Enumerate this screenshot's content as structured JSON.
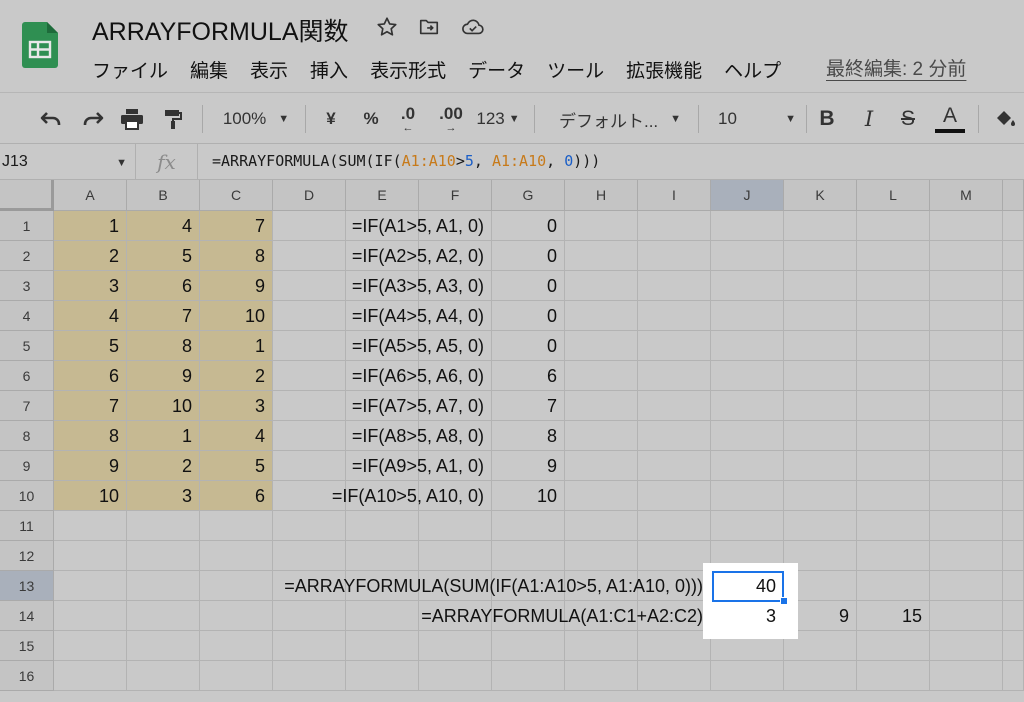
{
  "header": {
    "title": "ARRAYFORMULA関数",
    "menu": [
      "ファイル",
      "編集",
      "表示",
      "挿入",
      "表示形式",
      "データ",
      "ツール",
      "拡張機能",
      "ヘルプ"
    ],
    "last_edit": "最終編集: 2 分前"
  },
  "toolbar": {
    "zoom": "100%",
    "currency": "¥",
    "percent": "%",
    "decimal_decrease": ".0",
    "decimal_increase": ".00",
    "number_format": "123",
    "font": "デフォルト...",
    "font_size": "10",
    "bold": "B",
    "italic": "I",
    "strike": "S",
    "text_color": "A"
  },
  "formula_bar": {
    "name_box": "J13",
    "fx": "fx",
    "formula_parts": [
      {
        "t": "=ARRAYFORMULA(SUM(IF(",
        "c": ""
      },
      {
        "t": "A1:A10",
        "c": "ref-a"
      },
      {
        "t": ">",
        "c": ""
      },
      {
        "t": "5",
        "c": "ref-n"
      },
      {
        "t": ", ",
        "c": ""
      },
      {
        "t": "A1:A10",
        "c": "ref-a"
      },
      {
        "t": ", ",
        "c": ""
      },
      {
        "t": "0",
        "c": "ref-n"
      },
      {
        "t": ")))",
        "c": ""
      }
    ]
  },
  "sheet": {
    "columns": [
      "A",
      "B",
      "C",
      "D",
      "E",
      "F",
      "G",
      "H",
      "I",
      "J",
      "K",
      "L",
      "M"
    ],
    "rows": [
      "1",
      "2",
      "3",
      "4",
      "5",
      "6",
      "7",
      "8",
      "9",
      "10",
      "11",
      "12",
      "13",
      "14",
      "15",
      "16"
    ],
    "selected_cell": "J13",
    "col_A": [
      "1",
      "2",
      "3",
      "4",
      "5",
      "6",
      "7",
      "8",
      "9",
      "10"
    ],
    "col_B": [
      "4",
      "5",
      "6",
      "7",
      "8",
      "9",
      "10",
      "1",
      "2",
      "3"
    ],
    "col_C": [
      "7",
      "8",
      "9",
      "10",
      "1",
      "2",
      "3",
      "4",
      "5",
      "6"
    ],
    "col_E_formulas": [
      "=IF(A1>5, A1, 0)",
      "=IF(A2>5, A2, 0)",
      "=IF(A3>5, A3, 0)",
      "=IF(A4>5, A4, 0)",
      "=IF(A5>5, A5, 0)",
      "=IF(A6>5, A6, 0)",
      "=IF(A7>5, A7, 0)",
      "=IF(A8>5, A8, 0)",
      "=IF(A9>5, A1, 0)",
      "=IF(A10>5, A10, 0)"
    ],
    "col_G": [
      "0",
      "0",
      "0",
      "0",
      "0",
      "6",
      "7",
      "8",
      "9",
      "10"
    ],
    "row13_formula": "=ARRAYFORMULA(SUM(IF(A1:A10>5, A1:A10, 0)))",
    "row13_result": "40",
    "row14_formula": "=ARRAYFORMULA(A1:C1+A2:C2)",
    "row14_results": [
      "3",
      "9",
      "15"
    ]
  },
  "colors": {
    "highlight": "#c6b992",
    "selection": "#1a73e8",
    "range_ref": "#c77a1a",
    "number_ref": "#1a5ec7"
  }
}
